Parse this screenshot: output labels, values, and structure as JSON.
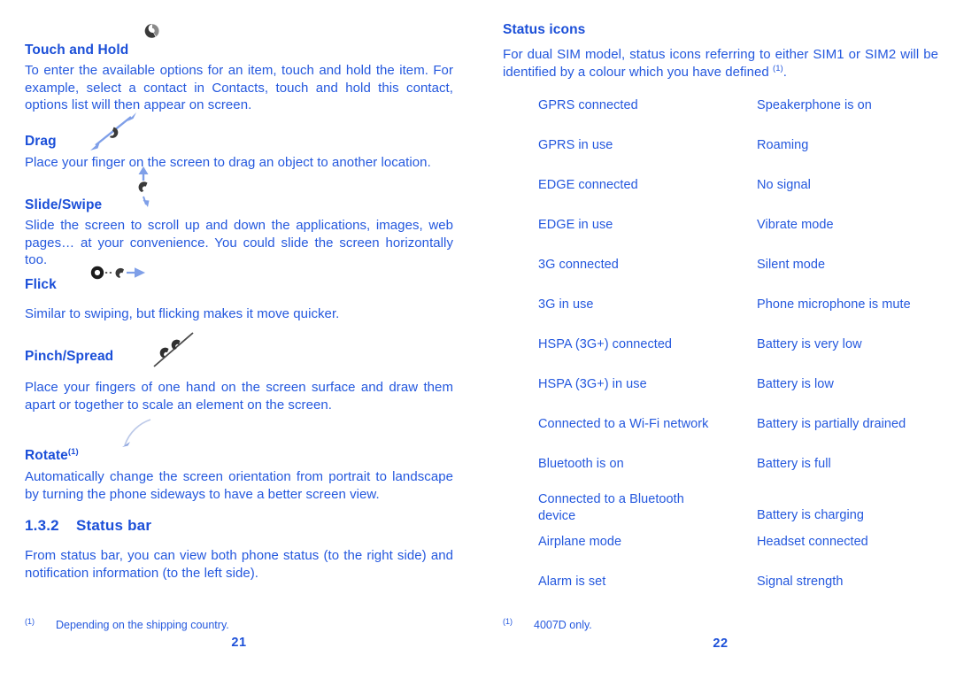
{
  "document": {
    "accent_color": "#1b4fd8",
    "body_color": "#2458de",
    "icon_dark_color": "#333333",
    "arrow_color": "#7f9fe8"
  },
  "left_page": {
    "page_number": "21",
    "sections": [
      {
        "heading": "Touch and Hold",
        "icon": "touch-hold-icon",
        "body": "To enter the available options for an item, touch and hold the item. For example, select a contact in Contacts, touch and hold this contact, options list will then appear on screen."
      },
      {
        "heading": "Drag",
        "icon": "drag-diagonal-arrow-icon",
        "body": "Place your finger on the screen to drag an object to another location."
      },
      {
        "heading": "Slide/Swipe",
        "icon": "slide-swipe-vertical-arrow-icon",
        "body": "Slide the screen to scroll up and down the applications, images, web pages… at your convenience. You could slide the screen horizontally too."
      },
      {
        "heading": "Flick",
        "icon": "flick-arrow-icon",
        "body": "Similar to swiping, but flicking makes it move quicker."
      },
      {
        "heading": "Pinch/Spread",
        "icon": "pinch-spread-icon",
        "body": "Place your fingers of one hand on the screen surface and draw them apart or together to scale an element on the screen."
      },
      {
        "heading": "Rotate",
        "heading_footnote": "(1)",
        "icon": "rotate-arc-icon",
        "body": "Automatically change the screen orientation from portrait to landscape by turning the phone sideways to have a better screen view."
      }
    ],
    "section_heading": {
      "number": "1.3.2",
      "title": "Status bar"
    },
    "section_body": "From status bar, you can view both phone status (to the right side) and notification information (to the left side).",
    "footnote": {
      "mark": "(1)",
      "text": "Depending on the shipping country."
    }
  },
  "right_page": {
    "page_number": "22",
    "heading": "Status icons",
    "intro_before_footnote": "For dual SIM model, status icons referring to either SIM1 or SIM2 will be identified by a colour which you have defined ",
    "intro_footnote_mark": "(1)",
    "intro_after_footnote": ".",
    "icon_rows": [
      {
        "left": "GPRS connected",
        "right": "Speakerphone is on"
      },
      {
        "left": "GPRS in use",
        "right": "Roaming"
      },
      {
        "left": "EDGE connected",
        "right": "No signal"
      },
      {
        "left": "EDGE in use",
        "right": "Vibrate mode"
      },
      {
        "left": "3G connected",
        "right": "Silent mode"
      },
      {
        "left": "3G in use",
        "right": "Phone microphone is mute"
      },
      {
        "left": "HSPA (3G+) connected",
        "right": "Battery is very low"
      },
      {
        "left": "HSPA (3G+) in use",
        "right": "Battery is low"
      },
      {
        "left": "Connected to a Wi-Fi network",
        "right": "Battery is partially drained"
      },
      {
        "left": "Bluetooth is on",
        "right": "Battery is full"
      },
      {
        "left": "Connected to a Bluetooth device",
        "right": "Battery is charging"
      },
      {
        "left": "Airplane mode",
        "right": "Headset connected"
      },
      {
        "left": "Alarm is set",
        "right": "Signal strength"
      }
    ],
    "footnote": {
      "mark": "(1)",
      "text": "4007D only."
    }
  }
}
